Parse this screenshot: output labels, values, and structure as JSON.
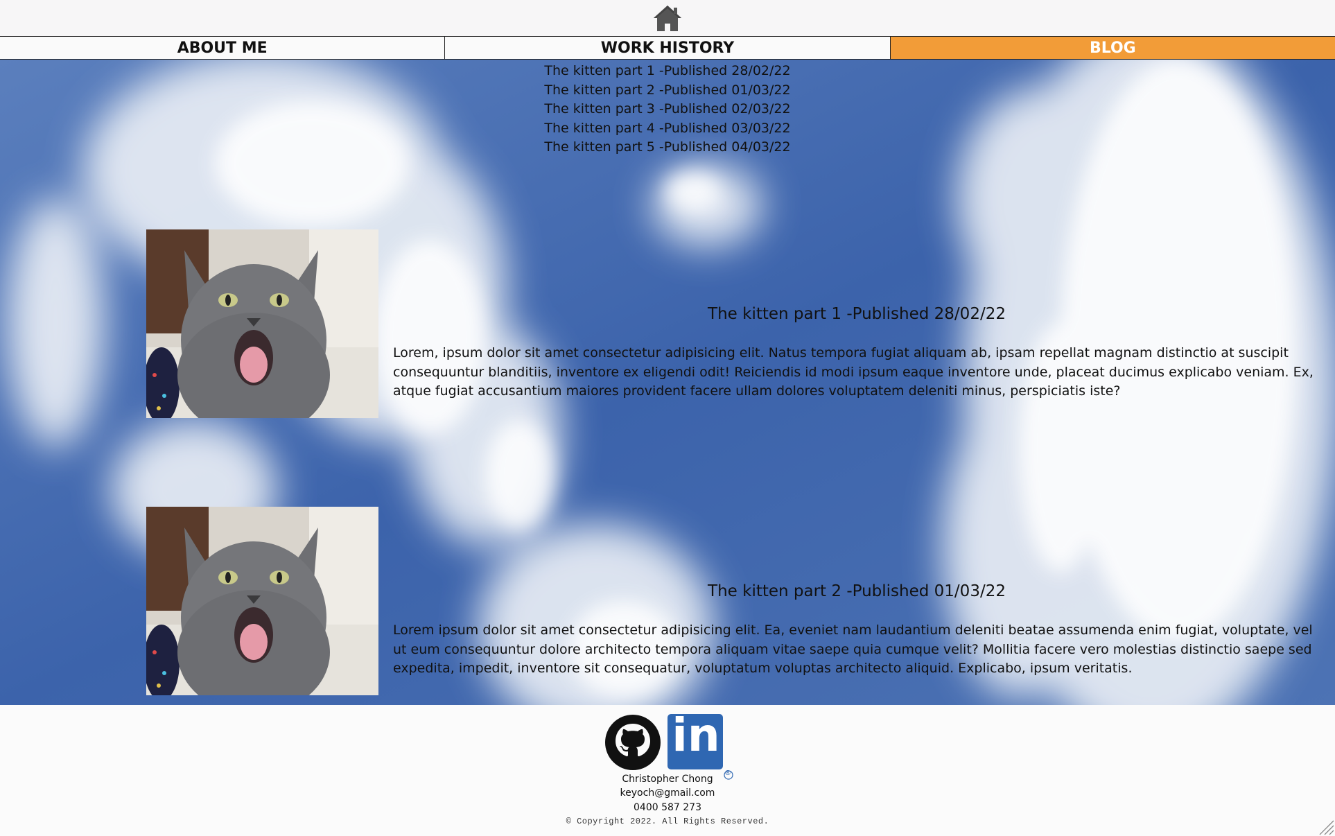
{
  "nav": {
    "tabs": [
      {
        "label": "ABOUT ME",
        "active": false
      },
      {
        "label": "WORK HISTORY",
        "active": false
      },
      {
        "label": "BLOG",
        "active": true
      }
    ],
    "active_color": "#f29c38"
  },
  "post_list": [
    "The kitten part 1 -Published 28/02/22",
    "The kitten part 2 -Published 01/03/22",
    "The kitten part 3 -Published 02/03/22",
    "The kitten part 4 -Published 03/03/22",
    "The kitten part 5 -Published 04/03/22"
  ],
  "posts": [
    {
      "title": "The kitten part 1 -Published 28/02/22",
      "body": "Lorem, ipsum dolor sit amet consectetur adipisicing elit. Natus tempora fugiat aliquam ab, ipsam repellat magnam distinctio at suscipit consequuntur blanditiis, inventore ex eligendi odit! Reiciendis id modi ipsum eaque inventore unde, placeat ducimus explicabo veniam. Ex, atque fugiat accusantium maiores provident facere ullam dolores voluptatem deleniti minus, perspiciatis iste?"
    },
    {
      "title": "The kitten part 2 -Published 01/03/22",
      "body": "Lorem ipsum dolor sit amet consectetur adipisicing elit. Ea, eveniet nam laudantium deleniti beatae assumenda enim fugiat, voluptate, vel ut eum consequuntur dolore architecto tempora aliquam vitae saepe quia cumque velit? Mollitia facere vero molestias distinctio saepe sed expedita, impedit, inventore sit consequatur, voluptatum voluptas architecto aliquid. Explicabo, ipsum veritatis."
    }
  ],
  "footer": {
    "name": "Christopher Chong",
    "email": "keyoch@gmail.com",
    "phone": "0400 587 273",
    "copyright": "© Copyright 2022. All Rights Reserved.",
    "linkedin_mark": "in",
    "registered_mark": "®"
  },
  "icons": {
    "home": "home-icon",
    "github": "github-icon",
    "linkedin": "linkedin-icon"
  }
}
